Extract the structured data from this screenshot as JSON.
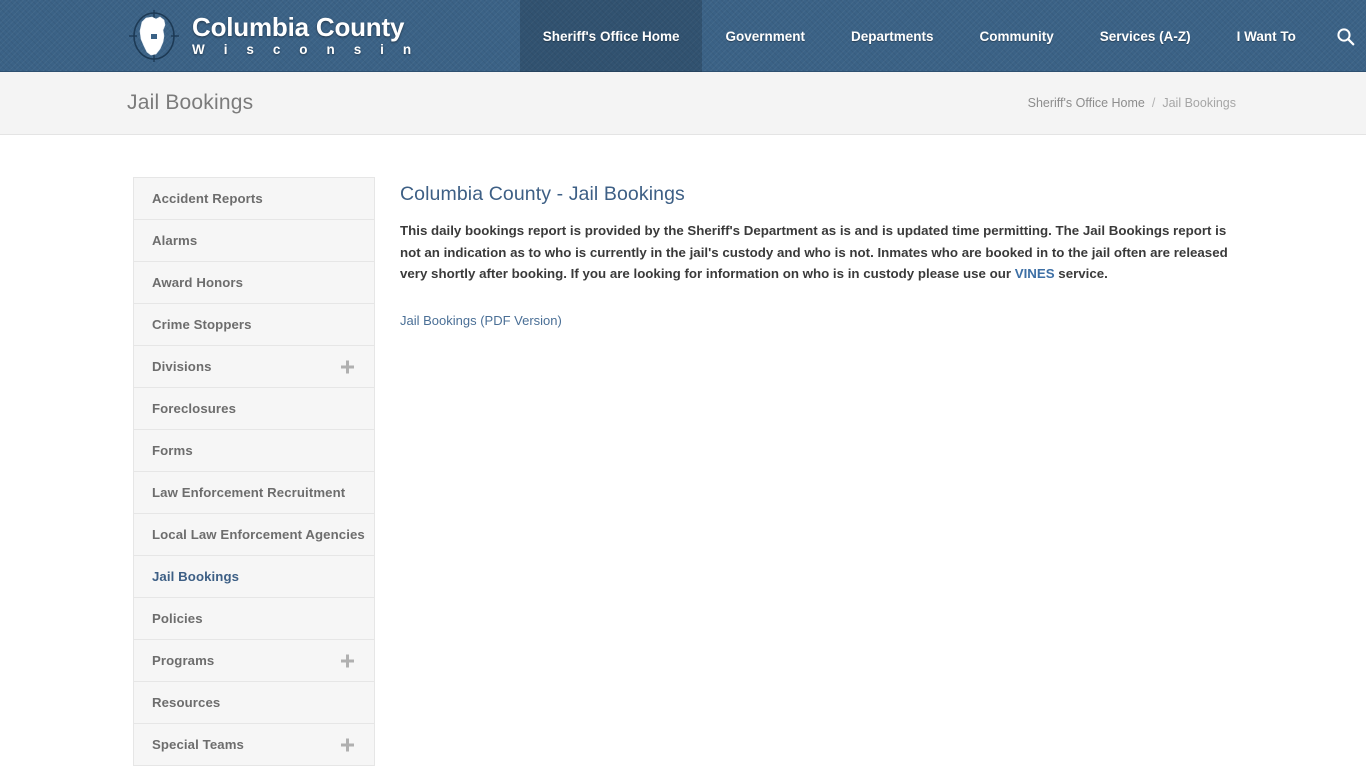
{
  "header": {
    "brand": {
      "title": "Columbia County",
      "subtitle": "W i s c o n s i n",
      "logo_icon": "wisconsin-state-outline-compass-icon"
    },
    "nav_items": [
      {
        "label": "Sheriff's Office Home",
        "active": true
      },
      {
        "label": "Government",
        "active": false
      },
      {
        "label": "Departments",
        "active": false
      },
      {
        "label": "Community",
        "active": false
      },
      {
        "label": "Services (A-Z)",
        "active": false
      },
      {
        "label": "I Want To",
        "active": false
      }
    ],
    "search_icon": "search-icon",
    "background_color": "#3b6286"
  },
  "banner": {
    "title": "Jail Bookings",
    "breadcrumb": {
      "parent": "Sheriff's Office Home",
      "separator": "/",
      "current": "Jail Bookings"
    }
  },
  "sidebar": {
    "items": [
      {
        "label": "Accident Reports",
        "expandable": false,
        "active": false
      },
      {
        "label": "Alarms",
        "expandable": false,
        "active": false
      },
      {
        "label": "Award Honors",
        "expandable": false,
        "active": false
      },
      {
        "label": "Crime Stoppers",
        "expandable": false,
        "active": false
      },
      {
        "label": "Divisions",
        "expandable": true,
        "active": false
      },
      {
        "label": "Foreclosures",
        "expandable": false,
        "active": false
      },
      {
        "label": "Forms",
        "expandable": false,
        "active": false
      },
      {
        "label": "Law Enforcement Recruitment",
        "expandable": false,
        "active": false
      },
      {
        "label": "Local Law Enforcement Agencies",
        "expandable": false,
        "active": false
      },
      {
        "label": "Jail Bookings",
        "expandable": false,
        "active": true
      },
      {
        "label": "Policies",
        "expandable": false,
        "active": false
      },
      {
        "label": "Programs",
        "expandable": true,
        "active": false
      },
      {
        "label": "Resources",
        "expandable": false,
        "active": false
      },
      {
        "label": "Special Teams",
        "expandable": true,
        "active": false
      }
    ]
  },
  "main": {
    "heading": "Columbia County - Jail Bookings",
    "paragraph_part1": "This daily bookings report is provided by the Sheriff's Department as is and is updated time permitting. The Jail Bookings report is not an indication as to who is currently in the jail's custody and who is not. Inmates who are booked in to the jail often are released very shortly after booking. If you are looking for information on who is in custody please use our ",
    "paragraph_link": "VINES",
    "paragraph_part2": " service.",
    "pdf_link": "Jail Bookings (PDF Version)"
  },
  "colors": {
    "header_blue": "#3b6286",
    "accent_link": "#3d6fa5",
    "heading_blue": "#3d5f85",
    "banner_bg": "#f4f4f4",
    "sidebar_item_bg": "#f6f6f6"
  }
}
